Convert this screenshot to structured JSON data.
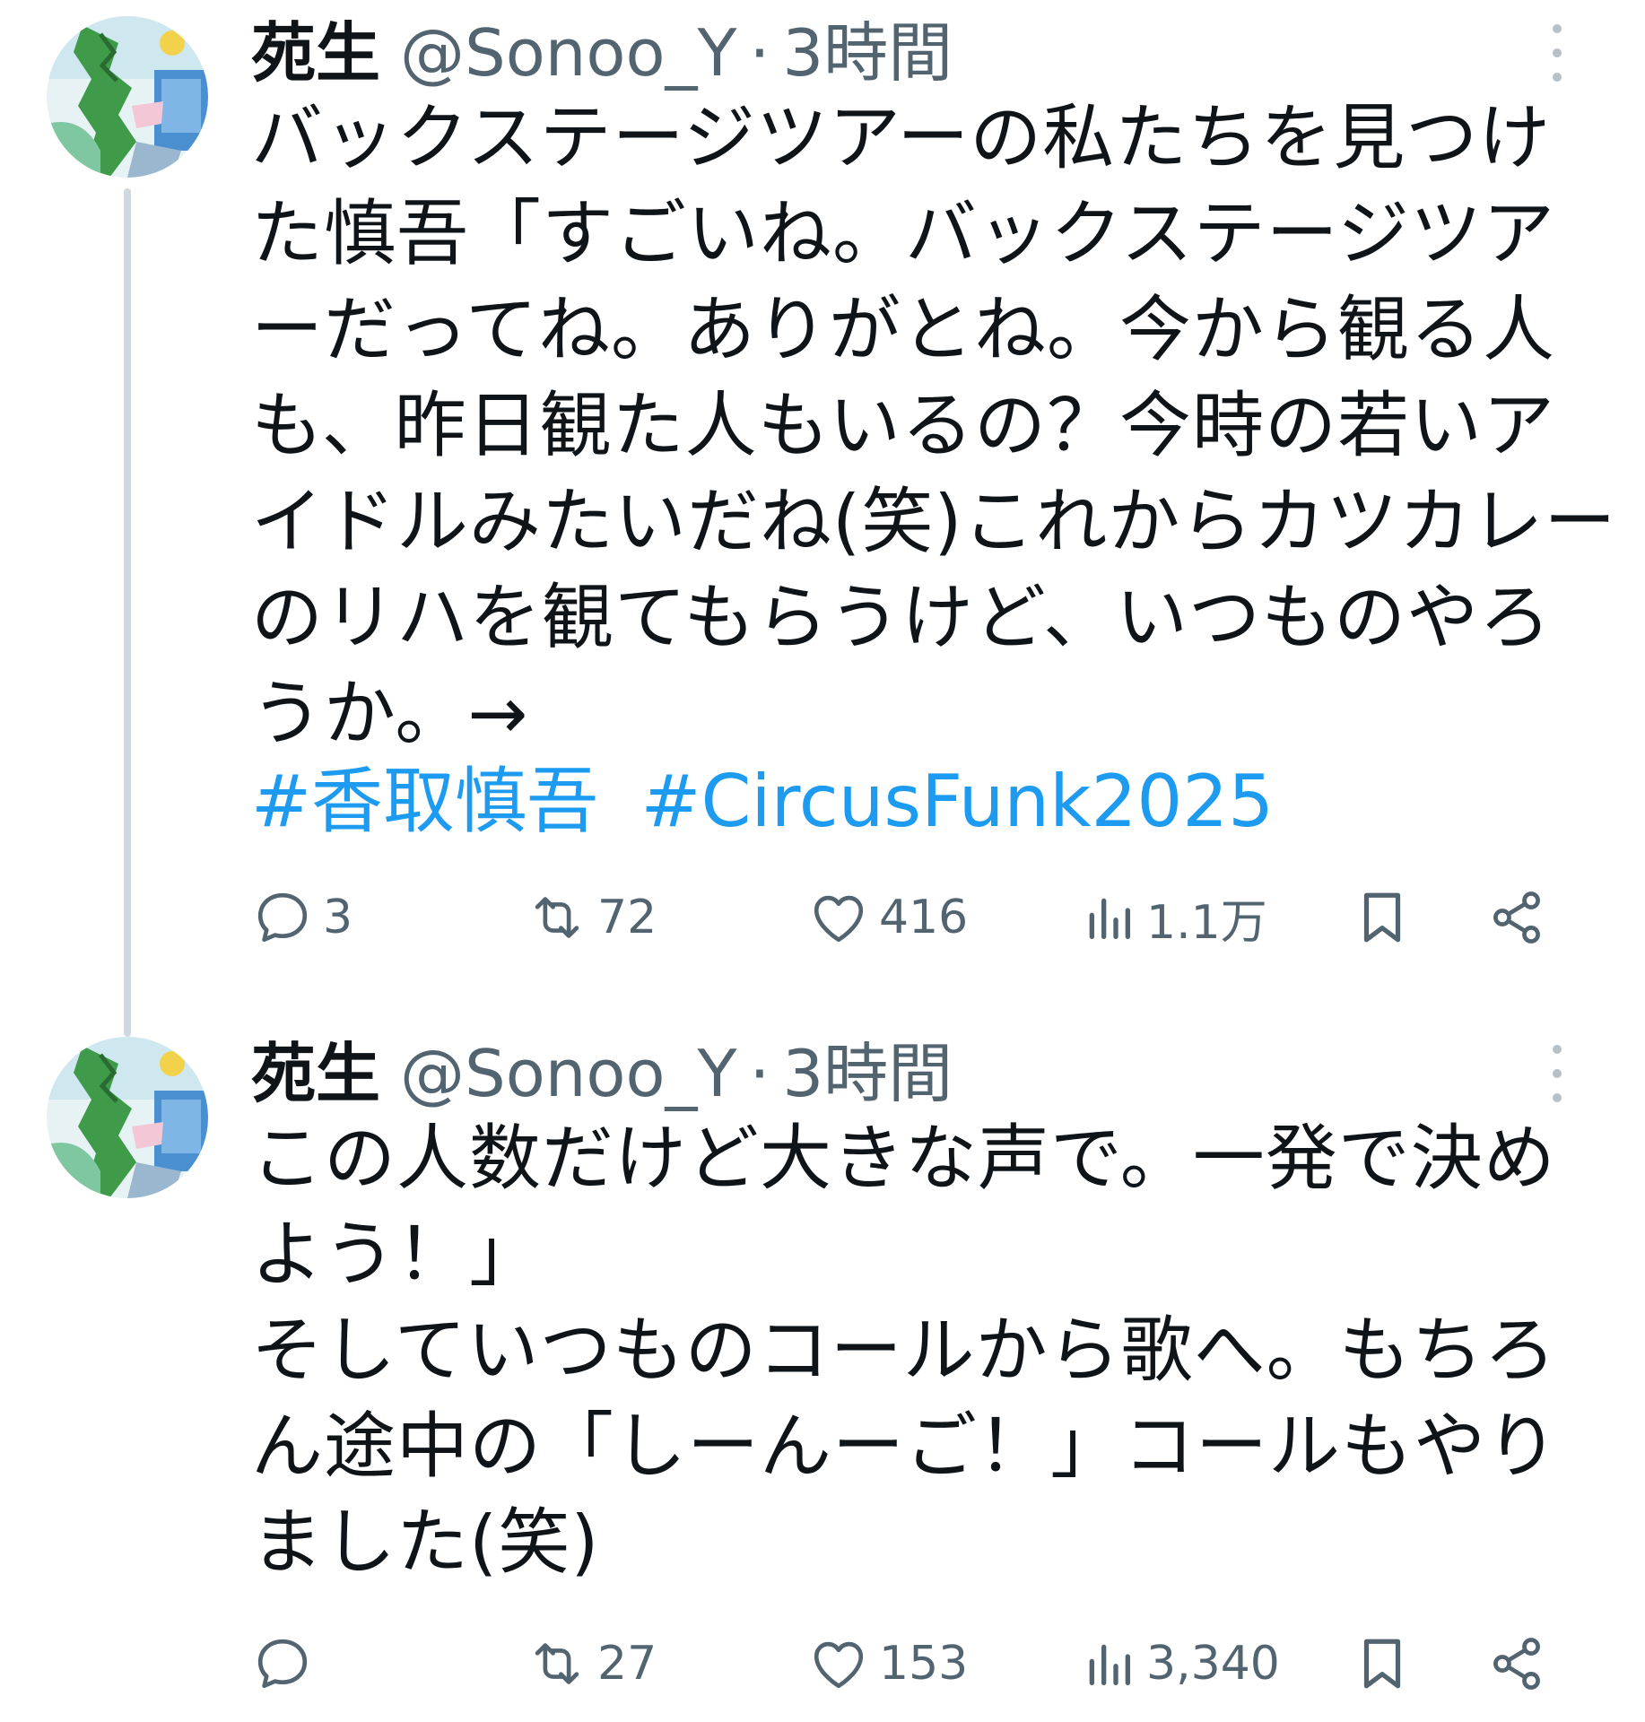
{
  "tweets": [
    {
      "author": {
        "name": "苑生",
        "handle": "@Sonoo_Y",
        "separator": "·",
        "time": "3時間"
      },
      "lines": [
        "バックステージツアーの私たちを見つけ",
        "た慎吾「すごいね。バックステージツア",
        "ーだってね。ありがとね。今から観る人",
        "も、昨日観た人もいるの？今時の若いア",
        "イドルみたいだね(笑)これからカツカレー",
        "のリハを観てもらうけど、いつものやろ",
        "うか。→"
      ],
      "hashtags": [
        "#香取慎吾",
        "#CircusFunk2025"
      ],
      "stats": {
        "replies": "3",
        "reposts": "72",
        "likes": "416",
        "views": "1.1万"
      }
    },
    {
      "author": {
        "name": "苑生",
        "handle": "@Sonoo_Y",
        "separator": "·",
        "time": "3時間"
      },
      "lines": [
        "この人数だけど大きな声で。一発で決め",
        "よう！」",
        "そしていつものコールから歌へ。もちろ",
        "ん途中の「しーんーご！」コールもやり",
        "ました(笑)"
      ],
      "stats": {
        "replies": "",
        "reposts": "27",
        "likes": "153",
        "views": "3,340"
      }
    }
  ],
  "icons": {
    "reply": "reply-icon",
    "repost": "repost-icon",
    "like": "heart-icon",
    "views": "views-icon",
    "bookmark": "bookmark-icon",
    "share": "share-icon",
    "more": "more-icon"
  },
  "colors": {
    "text": "#0f1419",
    "muted": "#536471",
    "hashtag": "#1d9bf0",
    "thread_line": "#cfd9de"
  }
}
